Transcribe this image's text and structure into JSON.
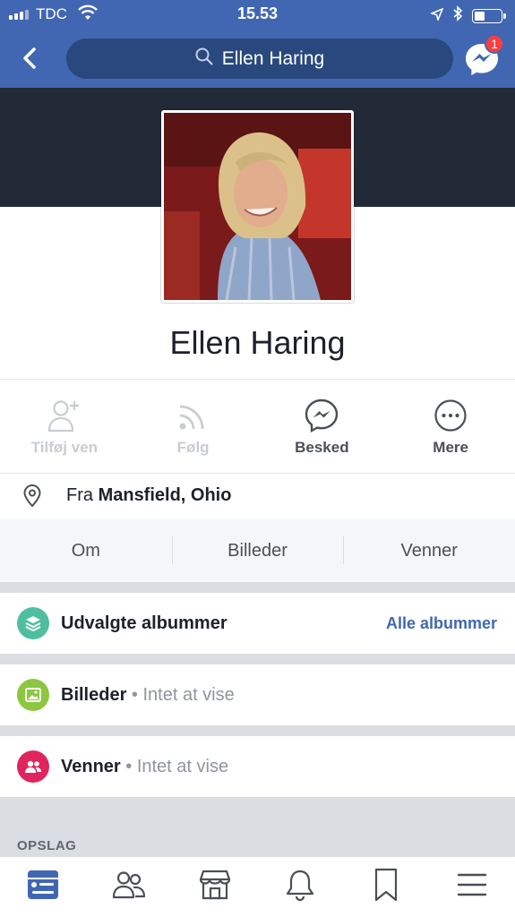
{
  "status_bar": {
    "carrier": "TDC",
    "time": "15.53"
  },
  "nav": {
    "search_text": "Ellen Haring",
    "messenger_badge": "1"
  },
  "profile": {
    "name": "Ellen Haring"
  },
  "actions": [
    {
      "label": "Tilføj ven",
      "icon": "add-friend-icon",
      "enabled": false
    },
    {
      "label": "Følg",
      "icon": "follow-icon",
      "enabled": false
    },
    {
      "label": "Besked",
      "icon": "messenger-icon",
      "enabled": true
    },
    {
      "label": "Mere",
      "icon": "more-icon",
      "enabled": true
    }
  ],
  "hometown": {
    "prefix": "Fra",
    "place": "Mansfield, Ohio"
  },
  "tabs": [
    "Om",
    "Billeder",
    "Venner"
  ],
  "sections": {
    "albums": {
      "title": "Udvalgte albummer",
      "link": "Alle albummer",
      "color": "#4fbea0"
    },
    "photos": {
      "title": "Billeder",
      "sub": " • Intet at vise",
      "color": "#8dc63f"
    },
    "friends": {
      "title": "Venner",
      "sub": " • Intet at vise",
      "color": "#e0245e"
    }
  },
  "posts_header": "OPSLAG",
  "colors": {
    "brand": "#4267b2",
    "link": "#4267b2",
    "cover": "#232a37"
  }
}
